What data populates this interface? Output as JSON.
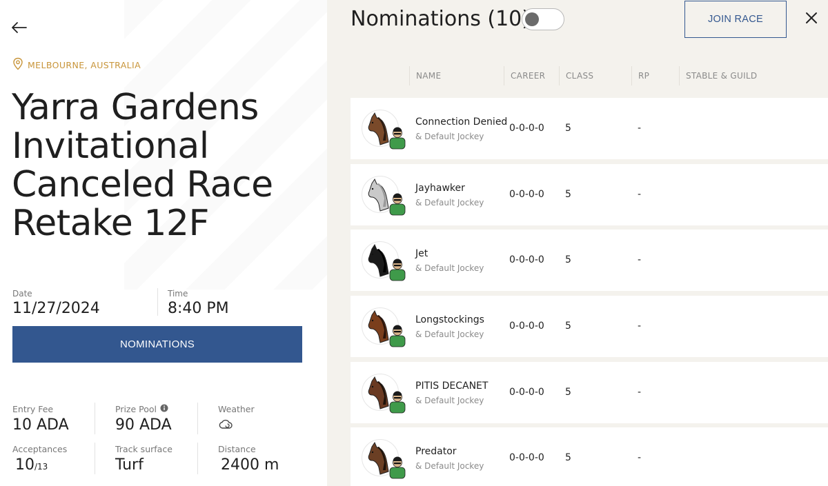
{
  "location": "MELBOURNE, AUSTRALIA",
  "race": {
    "title": "Yarra Gardens Invitational Canceled Race Retake 12F"
  },
  "schedule": {
    "date_label": "Date",
    "date_value": "11/27/2024",
    "time_label": "Time",
    "time_value": "8:40 PM"
  },
  "nominations_button": "NOMINATIONS",
  "stats": {
    "entry_fee_label": "Entry Fee",
    "entry_fee_value": "10 ADA",
    "prize_pool_label": "Prize Pool",
    "prize_pool_value": "90 ADA",
    "weather_label": "Weather",
    "weather_icon": "cloud-icon",
    "acceptances_label": "Acceptances",
    "acceptances_value": "10",
    "acceptances_max": "/13",
    "track_label": "Track surface",
    "track_value": "Turf",
    "distance_label": "Distance",
    "distance_value": "2400 m"
  },
  "panel": {
    "title": "Nominations (10)",
    "toggle_on": false,
    "join_label": "JOIN RACE"
  },
  "columns": [
    "NAME",
    "CAREER",
    "CLASS",
    "RP",
    "STABLE & GUILD"
  ],
  "colors": {
    "accent_blue": "#33578f",
    "location_gold": "#c8953a",
    "jockey_green": "#3f9a4a",
    "panel_bg": "#f4f2ed"
  },
  "nominations": [
    {
      "name": "Connection Denied",
      "jockey": "& Default Jockey",
      "career": "0-0-0-0",
      "class": "5",
      "rp": "-",
      "coat": "#7a4a2a",
      "mane": "#2a1a10"
    },
    {
      "name": "Jayhawker",
      "jockey": "& Default Jockey",
      "career": "0-0-0-0",
      "class": "5",
      "rp": "-",
      "coat": "#c9c9c9",
      "mane": "#9a9a9a"
    },
    {
      "name": "Jet",
      "jockey": "& Default Jockey",
      "career": "0-0-0-0",
      "class": "5",
      "rp": "-",
      "coat": "#1a1a1a",
      "mane": "#000000"
    },
    {
      "name": "Longstockings",
      "jockey": "& Default Jockey",
      "career": "0-0-0-0",
      "class": "5",
      "rp": "-",
      "coat": "#7a3e1c",
      "mane": "#2a140a"
    },
    {
      "name": "PITIS DECANET",
      "jockey": "& Default Jockey",
      "career": "0-0-0-0",
      "class": "5",
      "rp": "-",
      "coat": "#6a3a22",
      "mane": "#1e120a"
    },
    {
      "name": "Predator",
      "jockey": "& Default Jockey",
      "career": "0-0-0-0",
      "class": "5",
      "rp": "-",
      "coat": "#6b3f24",
      "mane": "#1e120a"
    }
  ]
}
